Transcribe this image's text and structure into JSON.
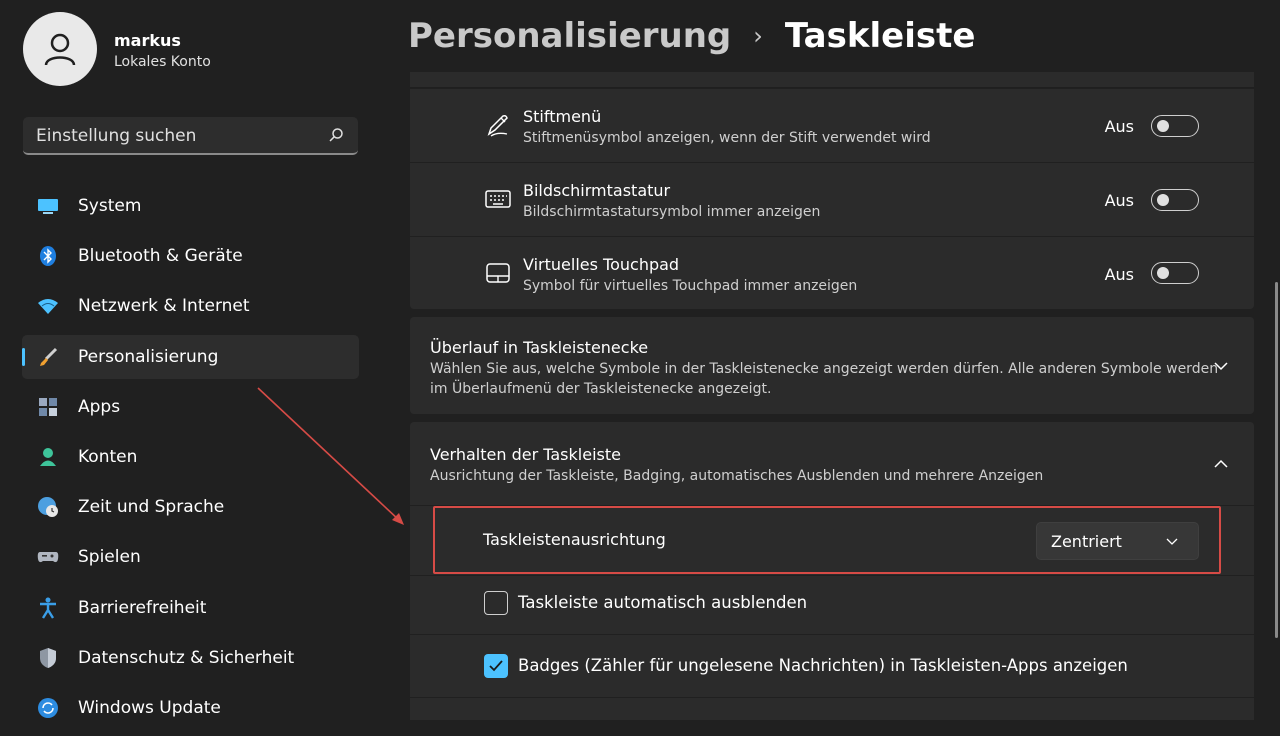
{
  "user": {
    "name": "markus",
    "account_type": "Lokales Konto"
  },
  "search": {
    "placeholder": "Einstellung suchen"
  },
  "sidebar": {
    "items": [
      {
        "label": "System",
        "icon": "monitor-icon"
      },
      {
        "label": "Bluetooth & Geräte",
        "icon": "bluetooth-icon"
      },
      {
        "label": "Netzwerk & Internet",
        "icon": "wifi-icon"
      },
      {
        "label": "Personalisierung",
        "icon": "brush-icon",
        "active": true
      },
      {
        "label": "Apps",
        "icon": "apps-icon"
      },
      {
        "label": "Konten",
        "icon": "person-icon"
      },
      {
        "label": "Zeit und Sprache",
        "icon": "globe-clock-icon"
      },
      {
        "label": "Spielen",
        "icon": "gamepad-icon"
      },
      {
        "label": "Barrierefreiheit",
        "icon": "accessibility-icon"
      },
      {
        "label": "Datenschutz & Sicherheit",
        "icon": "shield-icon"
      },
      {
        "label": "Windows Update",
        "icon": "update-icon"
      }
    ]
  },
  "breadcrumb": {
    "parent": "Personalisierung",
    "separator": "›",
    "current": "Taskleiste"
  },
  "settings": {
    "pen_menu": {
      "title": "Stiftmenü",
      "desc": "Stiftmenüsymbol anzeigen, wenn der Stift verwendet wird",
      "state": "Aus",
      "icon": "pen-icon"
    },
    "touch_keyboard": {
      "title": "Bildschirmtastatur",
      "desc": "Bildschirmtastatursymbol immer anzeigen",
      "state": "Aus",
      "icon": "keyboard-icon"
    },
    "virtual_touchpad": {
      "title": "Virtuelles Touchpad",
      "desc": "Symbol für virtuelles Touchpad immer anzeigen",
      "state": "Aus",
      "icon": "touchpad-icon"
    },
    "overflow": {
      "title": "Überlauf in Taskleistenecke",
      "desc_line1": "Wählen Sie aus, welche Symbole in der Taskleistenecke angezeigt werden dürfen. Alle anderen Symbole werden",
      "desc_line2": "im Überlaufmenü der Taskleistenecke angezeigt."
    },
    "behavior": {
      "title": "Verhalten der Taskleiste",
      "desc": "Ausrichtung der Taskleiste, Badging, automatisches Ausblenden und mehrere Anzeigen"
    },
    "alignment": {
      "label": "Taskleistenausrichtung",
      "value": "Zentriert"
    },
    "auto_hide": {
      "label": "Taskleiste automatisch ausblenden",
      "checked": false
    },
    "badges": {
      "label": "Badges (Zähler für ungelesene Nachrichten) in Taskleisten-Apps anzeigen",
      "checked": true
    }
  },
  "colors": {
    "accent": "#4cc2ff",
    "annotation": "#d64b46",
    "background": "#202020",
    "card": "#2b2b2b"
  }
}
